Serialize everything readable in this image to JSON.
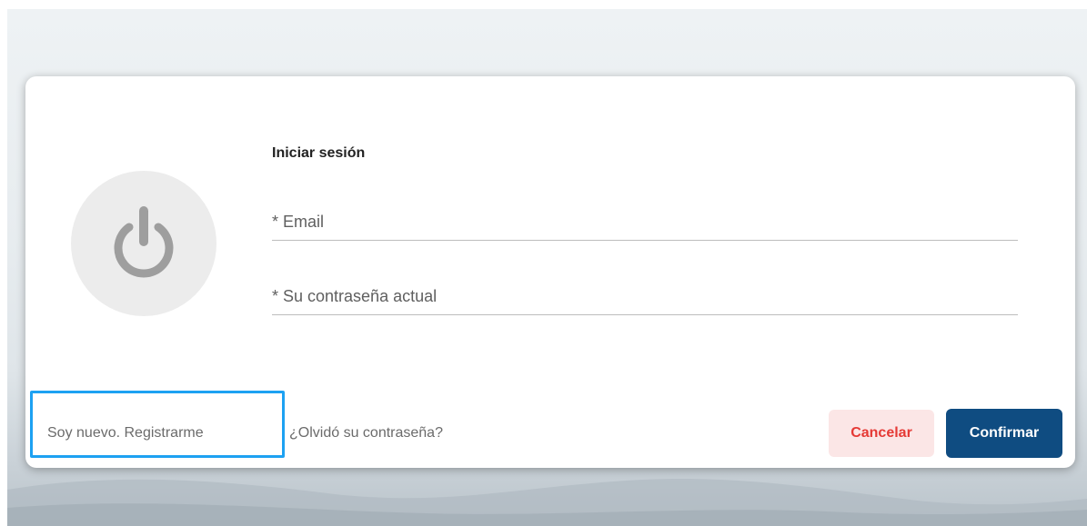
{
  "login": {
    "title": "Iniciar sesión",
    "email_placeholder": "* Email",
    "password_placeholder": "* Su contraseña actual",
    "register_label": "Soy nuevo. Registrarme",
    "forgot_label": "¿Olvidó su contraseña?",
    "cancel_label": "Cancelar",
    "confirm_label": "Confirmar"
  },
  "icons": {
    "hero": "power-icon"
  },
  "colors": {
    "confirm": "#0f4c81",
    "cancel_text": "#e53935",
    "cancel_bg": "#fbe6e6",
    "focus_outline": "#1da1f2",
    "icon_circle": "#ececec",
    "icon_glyph": "#9e9e9e"
  }
}
